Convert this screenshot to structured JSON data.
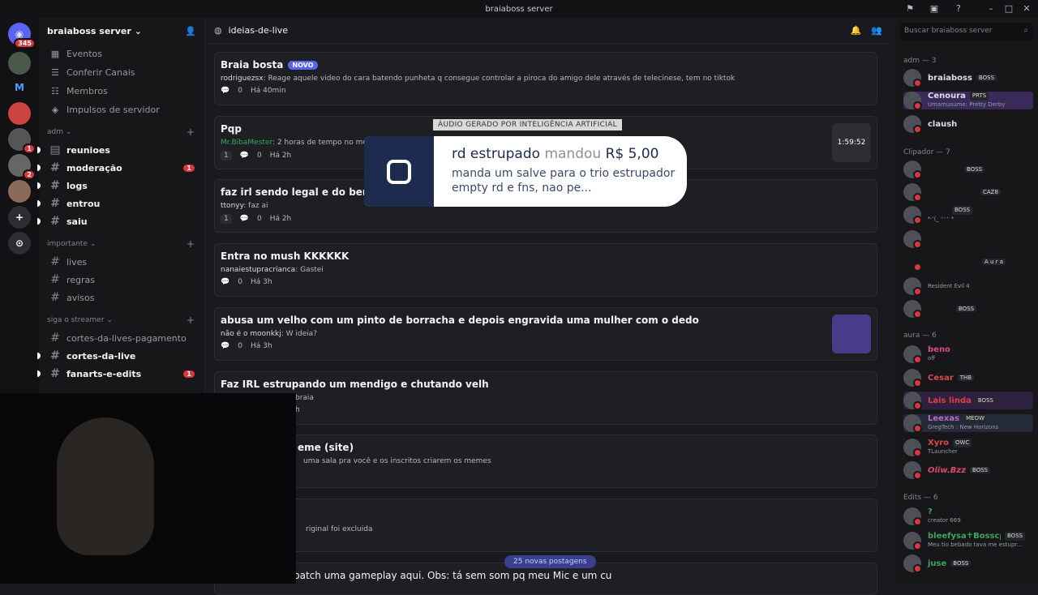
{
  "window": {
    "title": "braiaboss server"
  },
  "servers": [
    {
      "badge": "345"
    },
    {
      "label": ""
    },
    {
      "label": "M"
    },
    {
      "label": ""
    },
    {
      "badge": "1"
    },
    {
      "badge": "2"
    },
    {
      "label": ""
    }
  ],
  "sidebar": {
    "server_name": "braiaboss server",
    "nav": [
      {
        "label": "Eventos",
        "icon": "calendar-icon"
      },
      {
        "label": "Conferir Canais",
        "icon": "channels-icon"
      },
      {
        "label": "Membros",
        "icon": "members-icon"
      },
      {
        "label": "Impulsos de servidor",
        "icon": "boost-icon"
      }
    ],
    "categories": [
      {
        "name": "adm",
        "channels": [
          {
            "name": "reunioes",
            "unread": true
          },
          {
            "name": "moderação",
            "unread": true,
            "mention": "1"
          },
          {
            "name": "logs",
            "unread": true
          },
          {
            "name": "entrou",
            "unread": true
          },
          {
            "name": "saiu",
            "unread": true
          }
        ]
      },
      {
        "name": "importante",
        "channels": [
          {
            "name": "lives",
            "unread": false
          },
          {
            "name": "regras",
            "unread": false
          },
          {
            "name": "avisos",
            "unread": false
          }
        ]
      },
      {
        "name": "siga o streamer",
        "channels": [
          {
            "name": "cortes-da-lives-pagamento",
            "unread": false
          },
          {
            "name": "cortes-da-live",
            "unread": true
          },
          {
            "name": "fanarts-e-edits",
            "unread": true,
            "mention": "1"
          }
        ]
      }
    ]
  },
  "main": {
    "channel_name": "ideias-de-live",
    "new_posts": "25 novas postagens",
    "posts": [
      {
        "title": "Braia bosta",
        "tag": "NOVO",
        "author": "rodriguezsx",
        "preview": "Reage aquele video do cara batendo punheta q consegue controlar a piroca do amigo dele através de telecinese, tem no tiktok",
        "replies": "0",
        "time": "Há 40min"
      },
      {
        "title": "Pqp",
        "author": "Mr.BibaMester",
        "preview": "2 horas de tempo no modo lento",
        "reactions": "1",
        "replies": "0",
        "time": "Há 2h",
        "thumb_time": "1:59:52"
      },
      {
        "title": "faz irl sendo legal e do bem, e c",
        "author": "ttonyy",
        "preview": "faz ai",
        "reactions": "1",
        "replies": "0",
        "time": "Há 2h"
      },
      {
        "title": "Entra no mush KKKKKK",
        "author": "nanaiestupracrianca",
        "preview": "Gastei",
        "replies": "0",
        "time": "Há 3h"
      },
      {
        "title": "abusa um velho com um pinto de borracha e depois engravida uma mulher com o dedo",
        "author": "não é o moonkkj",
        "preview": "W ideia?",
        "replies": "0",
        "time": "Há 3h"
      },
      {
        "title": "Faz IRL estrupando um mendigo e chutando velh",
        "author": "",
        "preview": "braia",
        "replies": "",
        "time": "h"
      },
      {
        "title": "eme (site)",
        "author": "",
        "preview": "uma sala pra você e os inscritos criarem os memes",
        "replies": "",
        "time": ""
      },
      {
        "title": "",
        "author": "",
        "preview": "riginal foi excluida",
        "replies": "",
        "time": ""
      },
      {
        "title": "patch uma gameplay aqui. Obs: tá sem som pq meu Mic e um cu",
        "author": "",
        "preview": "",
        "replies": "",
        "time": ""
      }
    ]
  },
  "overlay": {
    "ai_label": "ÁUDIO GERADO POR INTELIGÊNCIA ARTIFICIAL",
    "donor": "rd estrupado",
    "sent": "mandou",
    "amount": "R$ 5,00",
    "message": "manda um salve para o trio estrupador empty rd e fns, nao pe..."
  },
  "members": {
    "search_placeholder": "Buscar braiaboss server",
    "sections": [
      {
        "title": "adm — 3",
        "list": [
          {
            "name": "braiaboss",
            "tag": "BOSS"
          },
          {
            "name": "Cenoura",
            "tag": "PRTS",
            "status": "Umamusume: Pretty Derby"
          },
          {
            "name": "claush"
          }
        ]
      },
      {
        "title": "Clipador — 7",
        "list": [
          {
            "name": "",
            "tag": "BOSS"
          },
          {
            "name": "",
            "tag": "CAZ8"
          },
          {
            "name": "",
            "tag": "BOSS",
            "status": "*·'(_ ⁺ᵕ⁺ *"
          },
          {
            "name": ""
          },
          {
            "name": "",
            "tag": "A u r a"
          },
          {
            "name": "",
            "status": "Resident Evil 4"
          },
          {
            "name": "",
            "tag": "BOSS"
          }
        ]
      },
      {
        "title": "aura — 6",
        "list": [
          {
            "name": "beno",
            "status": "off"
          },
          {
            "name": "Cesar",
            "tag": "THB"
          },
          {
            "name": "Lais linda",
            "tag": "BOSS"
          },
          {
            "name": "Leexas",
            "tag": "MEOW",
            "status": "GregTech : New Horizons"
          },
          {
            "name": "Xyro",
            "tag": "OWC",
            "status": "TLauncher"
          },
          {
            "name": "Oliw.Bzz",
            "tag": "BOSS"
          }
        ]
      },
      {
        "title": "Edits — 6",
        "list": [
          {
            "name": "?",
            "status": "creator 669"
          },
          {
            "name": "bleefysa✝Bosscp...",
            "tag": "BOSS",
            "status": "Meu tio bebado tava me estupr..."
          },
          {
            "name": "juse",
            "tag": "BOSS"
          }
        ]
      }
    ]
  }
}
